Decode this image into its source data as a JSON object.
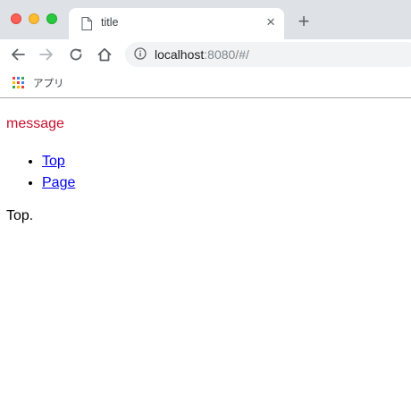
{
  "window": {
    "tab": {
      "title": "title",
      "close_glyph": "×",
      "icon": "page-icon"
    },
    "new_tab_glyph": "+"
  },
  "toolbar": {
    "url_host": "localhost",
    "url_rest": ":8080/#/"
  },
  "bookmarks": {
    "apps_label": "アプリ"
  },
  "page": {
    "message": "message",
    "nav_links": [
      {
        "label": "Top"
      },
      {
        "label": "Page"
      }
    ],
    "content": "Top."
  },
  "colors": {
    "message": "#c8102e",
    "link": "#0000ee",
    "tabstrip": "#dee1e6",
    "omnibox": "#f1f3f4"
  }
}
